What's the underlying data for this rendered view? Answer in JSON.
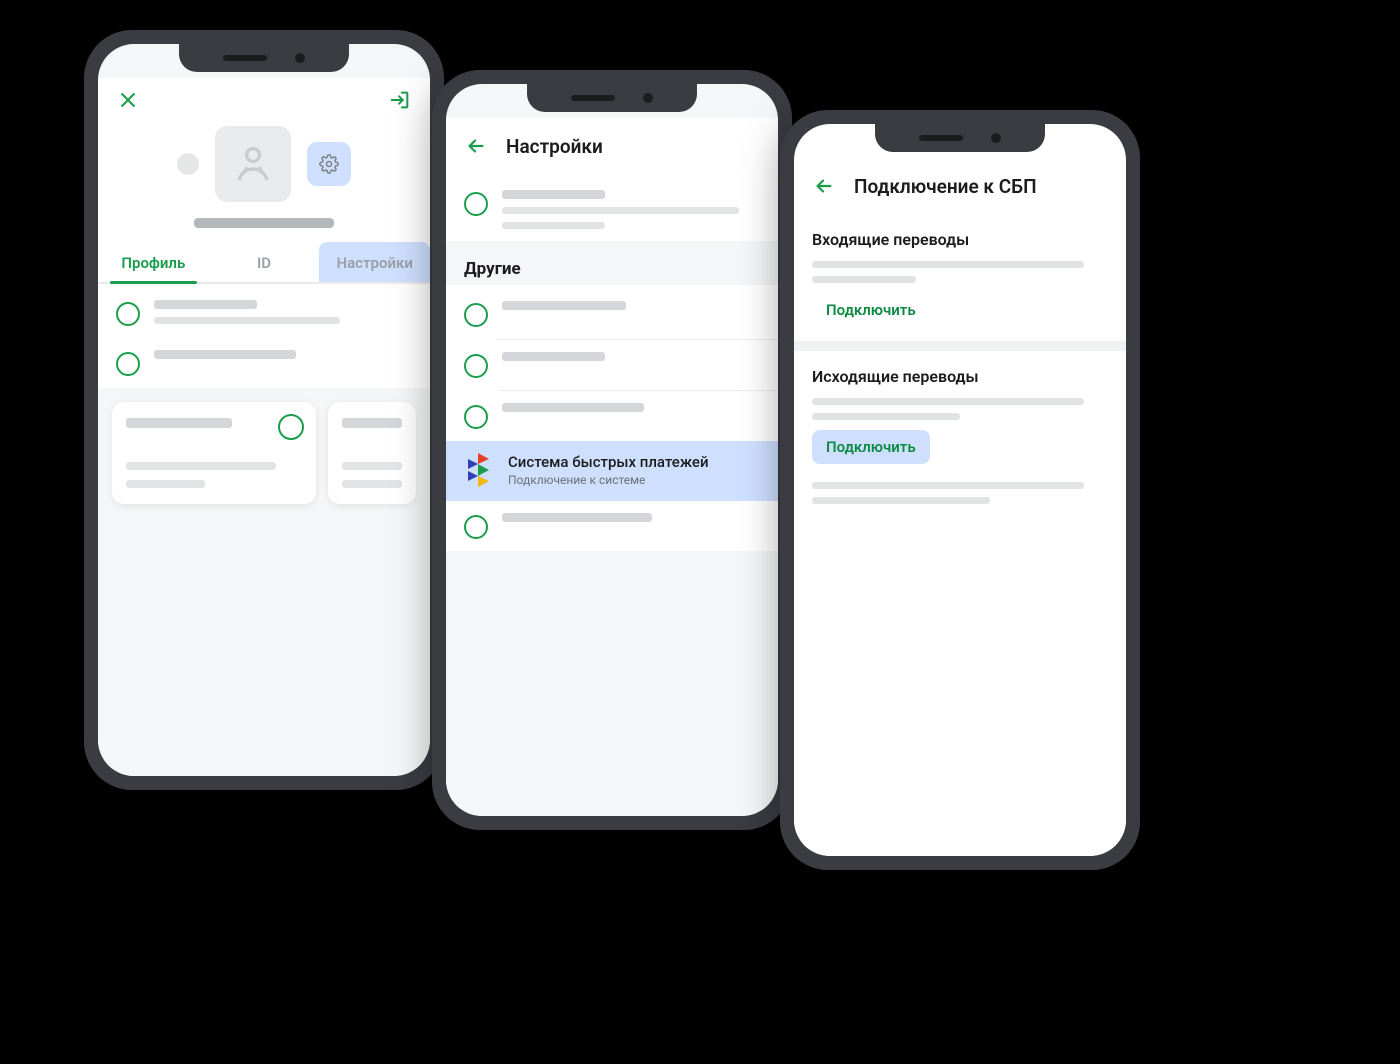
{
  "colors": {
    "accent": "#1a9e4b",
    "highlight": "#cfe0ff"
  },
  "phone1": {
    "tabs": {
      "profile": "Профиль",
      "id": "ID",
      "settings": "Настройки"
    }
  },
  "phone2": {
    "title": "Настройки",
    "section_other": "Другие",
    "sbp": {
      "title": "Система быстрых платежей",
      "subtitle": "Подключение к системе"
    }
  },
  "phone3": {
    "title": "Подключение к СБП",
    "incoming": {
      "heading": "Входящие переводы",
      "action": "Подключить"
    },
    "outgoing": {
      "heading": "Исходящие переводы",
      "action": "Подключить"
    }
  }
}
